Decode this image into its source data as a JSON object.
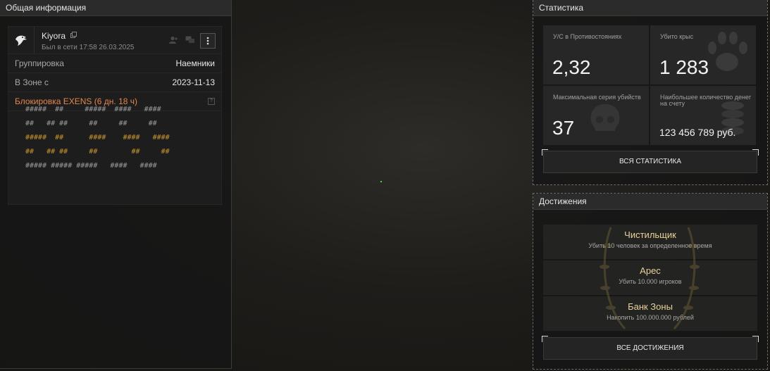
{
  "general": {
    "header": "Общая информация",
    "username": "Kiyora",
    "last_seen": "Был в сети 17:58 26.03.2025",
    "rows": [
      {
        "label": "Группировка",
        "value": "Наемники"
      },
      {
        "label": "В Зоне с",
        "value": "2023-11-13"
      }
    ],
    "ban_text": "Блокировка EXENS (6 дн. 18 ч)",
    "signature": [
      [
        {
          "t": "#####  ##     #####  ####   ####",
          "c": "w"
        }
      ],
      [
        {
          "t": "##   ## ##     ##     ##     ##",
          "c": "w"
        }
      ],
      [
        {
          "t": "#####  ##      ####    ####   ####",
          "c": "o"
        }
      ],
      [
        {
          "t": "##   ## ##     ##        ##     ##",
          "c": "o"
        }
      ],
      [
        {
          "t": "##### ##### #####   ####   ####",
          "c": "w"
        }
      ]
    ]
  },
  "stats": {
    "header": "Статистика",
    "cells": [
      {
        "label": "У/С в Противостояниях",
        "value": "2,32"
      },
      {
        "label": "Убито крыс",
        "value": "1 283"
      },
      {
        "label": "Максимальная серия убийств",
        "value": "37"
      },
      {
        "label": "Наибольшее количество денег на счету",
        "value": "123 456 789 руб."
      }
    ],
    "all_button": "ВСЯ СТАТИСТИКА"
  },
  "achievements": {
    "header": "Достижения",
    "items": [
      {
        "title": "Чистильщик",
        "desc": "Убить 10 человек за определенное время"
      },
      {
        "title": "Арес",
        "desc": "Убить 10.000 игроков"
      },
      {
        "title": "Банк Зоны",
        "desc": "Накопить 100.000.000 рублей"
      }
    ],
    "all_button": "ВСЕ ДОСТИЖЕНИЯ"
  },
  "colors": {
    "accent_gold": "#e8d29a",
    "ban_orange": "#e3864e",
    "signature_orange": "#c8942c"
  }
}
